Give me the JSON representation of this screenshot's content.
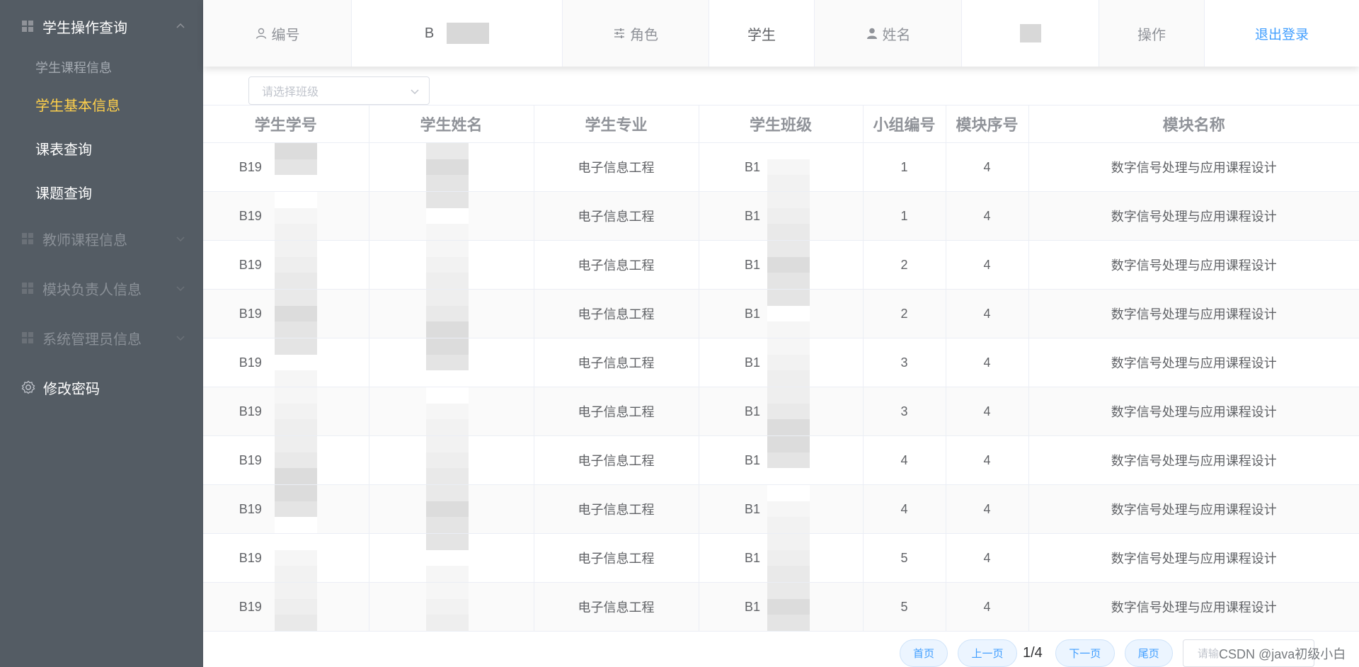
{
  "sidebar": {
    "group_student": "学生操作查询",
    "sub_course_info": "学生课程信息",
    "sub_basic_info": "学生基本信息",
    "sub_schedule": "课表查询",
    "sub_topic": "课题查询",
    "group_teacher": "教师课程信息",
    "group_module_lead": "模块负责人信息",
    "group_admin": "系统管理员信息",
    "change_password": "修改密码"
  },
  "infobar": {
    "id_label": "编号",
    "id_value": "B",
    "role_label": "角色",
    "role_value": "学生",
    "name_label": "姓名",
    "action_label": "操作",
    "logout": "退出登录"
  },
  "filter": {
    "class_placeholder": "请选择班级"
  },
  "table": {
    "headers": [
      "学生学号",
      "学生姓名",
      "学生专业",
      "学生班级",
      "小组编号",
      "模块序号",
      "模块名称"
    ],
    "rows": [
      {
        "id": "B19",
        "major": "电子信息工程",
        "class": "B1",
        "group": "1",
        "module_no": "4",
        "module_name": "数字信号处理与应用课程设计"
      },
      {
        "id": "B19",
        "major": "电子信息工程",
        "class": "B1",
        "group": "1",
        "module_no": "4",
        "module_name": "数字信号处理与应用课程设计"
      },
      {
        "id": "B19",
        "major": "电子信息工程",
        "class": "B1",
        "group": "2",
        "module_no": "4",
        "module_name": "数字信号处理与应用课程设计"
      },
      {
        "id": "B19",
        "major": "电子信息工程",
        "class": "B1",
        "group": "2",
        "module_no": "4",
        "module_name": "数字信号处理与应用课程设计"
      },
      {
        "id": "B19",
        "major": "电子信息工程",
        "class": "B1",
        "group": "3",
        "module_no": "4",
        "module_name": "数字信号处理与应用课程设计"
      },
      {
        "id": "B19",
        "major": "电子信息工程",
        "class": "B1",
        "group": "3",
        "module_no": "4",
        "module_name": "数字信号处理与应用课程设计"
      },
      {
        "id": "B19",
        "major": "电子信息工程",
        "class": "B1",
        "group": "4",
        "module_no": "4",
        "module_name": "数字信号处理与应用课程设计"
      },
      {
        "id": "B19",
        "major": "电子信息工程",
        "class": "B1",
        "group": "4",
        "module_no": "4",
        "module_name": "数字信号处理与应用课程设计"
      },
      {
        "id": "B19",
        "major": "电子信息工程",
        "class": "B1",
        "group": "5",
        "module_no": "4",
        "module_name": "数字信号处理与应用课程设计"
      },
      {
        "id": "B19",
        "major": "电子信息工程",
        "class": "B1",
        "group": "5",
        "module_no": "4",
        "module_name": "数字信号处理与应用课程设计"
      }
    ]
  },
  "pager": {
    "first": "首页",
    "prev": "上一页",
    "info": "1/4",
    "next": "下一页",
    "last": "尾页",
    "input_placeholder": "请输"
  },
  "watermark": "CSDN @java初级小白",
  "colors": {
    "sidebar_bg": "#545c64",
    "active": "#ffd04b",
    "link": "#409eff"
  },
  "icons": [
    "grid-icon",
    "chevron-up-icon",
    "chevron-down-icon",
    "gear-icon",
    "user-icon",
    "sliders-icon",
    "person-icon"
  ]
}
